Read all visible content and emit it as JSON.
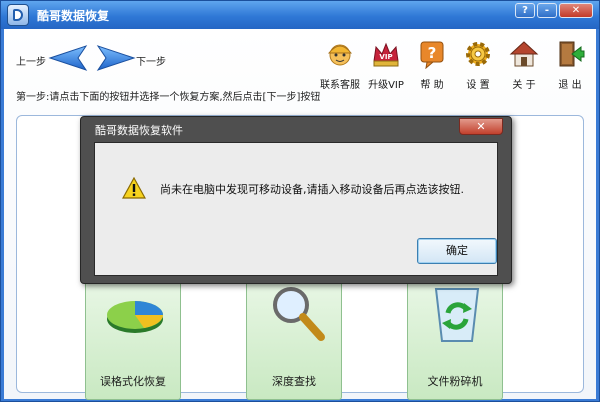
{
  "window": {
    "title": "酷哥数据恢复",
    "help_button": "?",
    "minimize_button": "-",
    "close_button": "✕"
  },
  "nav": {
    "prev_label": "上一步",
    "next_label": "下一步"
  },
  "step_instruction": "第一步:请点击下面的按钮并选择一个恢复方案,然后点击[下一步]按钮",
  "toolbar": [
    {
      "label": "联系客服",
      "icon": "customer-service-icon"
    },
    {
      "label": "升级VIP",
      "icon": "vip-crown-icon"
    },
    {
      "label": "帮  助",
      "icon": "help-icon"
    },
    {
      "label": "设  置",
      "icon": "gear-icon"
    },
    {
      "label": "关  于",
      "icon": "home-icon"
    },
    {
      "label": "退  出",
      "icon": "exit-icon"
    }
  ],
  "recovery_options": [
    {
      "label": "误格式化恢复",
      "icon": "pie-chart-icon"
    },
    {
      "label": "深度查找",
      "icon": "magnifier-icon"
    },
    {
      "label": "文件粉碎机",
      "icon": "recycle-bin-icon"
    }
  ],
  "dialog": {
    "title": "酷哥数据恢复软件",
    "close_button": "✕",
    "message": "尚未在电脑中发现可移动设备,请插入移动设备后再点选该按钮.",
    "ok_button": "确定"
  }
}
